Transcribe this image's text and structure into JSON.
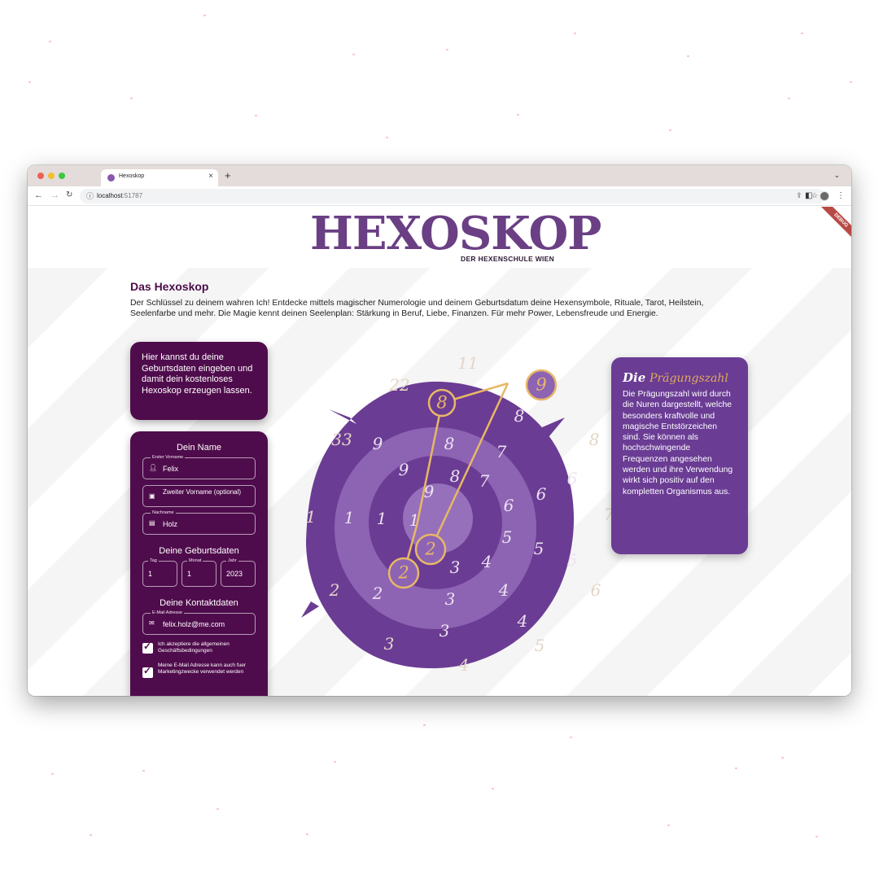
{
  "browser": {
    "tab_title": "Hexoskop",
    "url_host": "localhost",
    "url_port": ":51787",
    "new_tab_icon": "plus-icon",
    "close_tab_icon": "close-icon"
  },
  "header": {
    "logo_text": "HEXOSKOP",
    "logo_subtitle": "DER HEXENSCHULE WIEN",
    "debug_banner": "DEBUG"
  },
  "intro": {
    "title": "Das Hexoskop",
    "text": "Der Schlüssel zu deinem wahren Ich! Entdecke mittels magischer Numerologie und deinem Geburtsdatum deine Hexensymbole, Rituale, Tarot, Heilstein, Seelenfarbe und mehr. Die Magie kennt deinen Seelenplan: Stärkung in Beruf, Liebe, Finanzen. Für mehr Power, Lebensfreude und Energie."
  },
  "hint_card": {
    "text": "Hier kannst du deine Geburtsdaten eingeben und damit dein kostenloses Hexoskop erzeugen lassen."
  },
  "form": {
    "name_section": "Dein Name",
    "first_name": {
      "label": "Erster Vorname",
      "value": "Felix"
    },
    "second_name": {
      "placeholder": "Zweiter Vorname (optional)"
    },
    "last_name": {
      "label": "Nachname",
      "value": "Holz"
    },
    "birth_section": "Deine Geburtsdaten",
    "day": {
      "label": "Tag",
      "value": "1"
    },
    "month": {
      "label": "Monat",
      "value": "1"
    },
    "year": {
      "label": "Jahr",
      "value": "2023"
    },
    "contact_section": "Deine Kontaktdaten",
    "email": {
      "label": "E-Mail Adresse",
      "value": "felix.holz@me.com"
    },
    "terms_checkbox": {
      "label": "Ich akzeptiere die allgemeinen Geschäftsbedingungen",
      "checked": true
    },
    "marketing_checkbox": {
      "label": "Meine E-Mail Adresse kann auch fuer Marketingzwecke verwendet werden",
      "checked": true
    }
  },
  "wheel": {
    "colors": {
      "outer": "#6b3c94",
      "middle": "#8d63b3",
      "inner_ring": "#6b3c94",
      "center": "#9670bb",
      "gold": "#e7b866"
    },
    "outer_numbers": [
      "11",
      "8",
      "7",
      "6",
      "5",
      "4",
      "3",
      "2",
      "1",
      "33",
      "22"
    ],
    "ring1_numbers": [
      "9",
      "8",
      "7",
      "6",
      "5",
      "4",
      "3",
      "2",
      "1",
      "9"
    ],
    "ring2_numbers": [
      "8",
      "7",
      "6",
      "5",
      "4",
      "3",
      "2",
      "1",
      "9"
    ],
    "ring3_numbers": [
      "8",
      "7",
      "6",
      "5",
      "4",
      "3",
      "2",
      "1",
      "9"
    ],
    "ring4_numbers": [
      "7",
      "6",
      "5",
      "4",
      "3",
      "2",
      "1"
    ],
    "highlighted_numbers": [
      "9",
      "8",
      "2",
      "2"
    ]
  },
  "info_card": {
    "title_word1": "Die",
    "title_word2": "Prägungszahl",
    "text": "Die Prägungszahl wird durch die Nuren dargestellt, welche besonders kraftvolle und magische Entstörzeichen sind. Sie können als hochschwingende Frequenzen angesehen werden und ihre Verwendung wirkt sich positiv auf den kompletten Organismus aus."
  }
}
